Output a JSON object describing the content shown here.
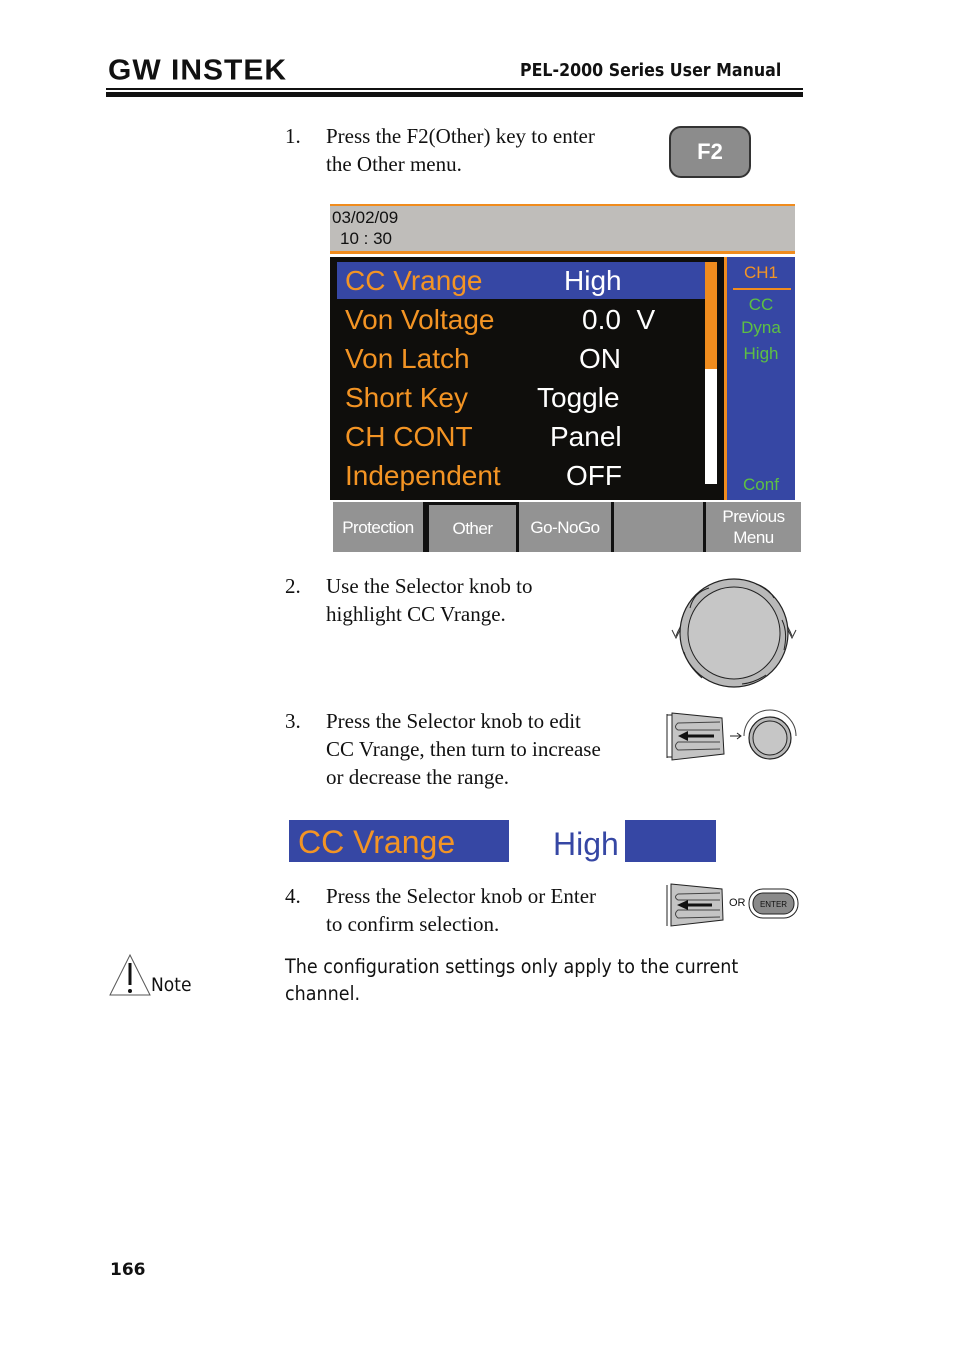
{
  "header": {
    "brand": "GW INSTEK",
    "manual_title": "PEL-2000 Series User Manual"
  },
  "steps": [
    {
      "num": "1.",
      "lines": [
        "Press the F2(Other) key to enter",
        "the Other menu."
      ]
    },
    {
      "num": "2.",
      "lines": [
        "Use the Selector knob to",
        "highlight CC Vrange."
      ]
    },
    {
      "num": "3.",
      "lines": [
        "Press the Selector knob to edit",
        "CC Vrange, then turn to increase",
        "or decrease the range."
      ]
    },
    {
      "num": "4.",
      "lines": [
        "Press the Selector knob or Enter",
        "to confirm selection."
      ]
    }
  ],
  "f2_key": {
    "label": "F2"
  },
  "screen": {
    "date": "03/02/09",
    "time": "10 : 30",
    "menu_rows": [
      {
        "label": "CC Vrange",
        "value": "High",
        "selected": true
      },
      {
        "label": "Von Voltage",
        "value": "0.0  V",
        "selected": false
      },
      {
        "label": "Von Latch",
        "value": "ON",
        "selected": false
      },
      {
        "label": "Short Key",
        "value": "Toggle",
        "selected": false
      },
      {
        "label": "CH CONT",
        "value": "Panel",
        "selected": false
      },
      {
        "label": "Independent",
        "value": "OFF",
        "selected": false
      }
    ],
    "scroll_position_fraction": 0.48,
    "side_panel": {
      "channel": "CH1",
      "mode": "CC",
      "dyna": "Dyna",
      "range": "High",
      "conf": "Conf"
    },
    "softkeys": [
      {
        "label": "Protection"
      },
      {
        "label": "Other",
        "active": true
      },
      {
        "label": "Go-NoGo"
      },
      {
        "label": ""
      },
      {
        "label": "Previous Menu"
      }
    ],
    "colors": {
      "label": "#f39424",
      "highlight": "#3647a4",
      "status": "#5dc043",
      "softkey": "#939393"
    }
  },
  "highlight_example": {
    "label": "CC Vrange",
    "value": "High"
  },
  "enter_icon": {
    "or_label": "OR",
    "enter_label": "ENTER"
  },
  "note": {
    "label": "Note",
    "text": "The configuration settings only apply to the current channel."
  },
  "page_number": "166"
}
